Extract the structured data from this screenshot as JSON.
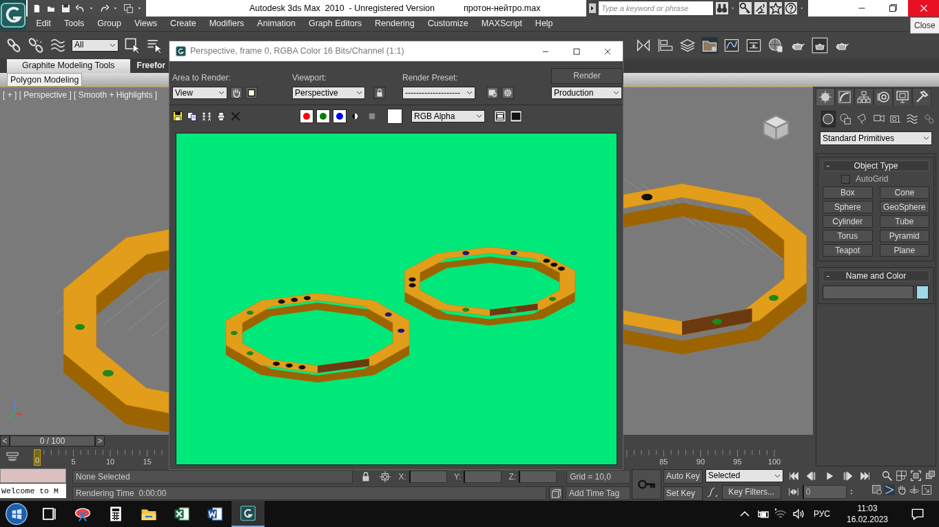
{
  "window": {
    "title": "Autodesk 3ds Max  2010  - Unregistered Version",
    "file_name": "протон-нейтро.max",
    "close_tooltip": "Close"
  },
  "search": {
    "placeholder": "Type a keyword or phrase"
  },
  "menu": [
    "Edit",
    "Tools",
    "Group",
    "Views",
    "Create",
    "Modifiers",
    "Animation",
    "Graph Editors",
    "Rendering",
    "Customize",
    "MAXScript",
    "Help"
  ],
  "toolbar": {
    "selection_filter": "All"
  },
  "ribbon": {
    "tabs": [
      {
        "label": "Graphite Modeling Tools",
        "selected": true
      },
      {
        "label": "Freefor",
        "selected": false
      }
    ],
    "panel_tab": "Polygon Modeling"
  },
  "viewport": {
    "label": "[ + ] [ Perspective ] [ Smooth + Highlights ]"
  },
  "command_panel": {
    "tabs": [
      {
        "selected": true
      },
      {
        "selected": false
      },
      {
        "selected": false
      },
      {
        "selected": false
      },
      {
        "selected": false
      },
      {
        "selected": false
      }
    ],
    "categories": [
      {
        "selected": true
      },
      {
        "selected": false
      },
      {
        "selected": false
      },
      {
        "selected": false
      },
      {
        "selected": false
      },
      {
        "selected": false
      },
      {
        "selected": false
      }
    ],
    "type_list": "Standard Primitives",
    "object_type": {
      "collapse_toggle": "-",
      "title": "Object Type",
      "autogrid": {
        "label": "AutoGrid",
        "checked": false
      },
      "buttons": [
        "Box",
        "Cone",
        "Sphere",
        "GeoSphere",
        "Cylinder",
        "Tube",
        "Torus",
        "Pyramid",
        "Teapot",
        "Plane"
      ]
    },
    "name_and_color": {
      "collapse_toggle": "-",
      "title": "Name and Color"
    }
  },
  "time_slider": {
    "prev": "<",
    "position": "0 / 100",
    "next": ">",
    "level": 0
  },
  "track_bar": {
    "current_frame": "0",
    "ticks": [
      "5",
      "10",
      "15",
      "85",
      "90",
      "95",
      "100"
    ]
  },
  "status": {
    "maxscript_output": "Welcome to M",
    "selection": "None Selected",
    "render_time": "Rendering Time  0:00:00",
    "x_label": "X:",
    "y_label": "Y:",
    "z_label": "Z:",
    "grid": "Grid = 10,0",
    "time_tag": "Add Time Tag"
  },
  "animation": {
    "auto_key": {
      "label": "Auto Key",
      "on": false
    },
    "set_key": "Set Key",
    "key_mode": "Selected",
    "key_filters": "Key Filters...",
    "frame": "0"
  },
  "render_window": {
    "title": "Perspective, frame 0, RGBA Color 16 Bits/Channel (1:1)",
    "area_label": "Area to Render:",
    "area": "View",
    "viewport_label": "Viewport:",
    "viewport": "Perspective",
    "preset_label": "Render Preset:",
    "preset": "--------------------",
    "render_button": "Render",
    "mode": "Production",
    "channel_display": "RGB Alpha",
    "channels": [
      {
        "color": "#ff0000",
        "on": true
      },
      {
        "color": "#008000",
        "on": true
      },
      {
        "color": "#0000ff",
        "on": true
      }
    ]
  },
  "taskbar": {
    "apps": [
      {
        "kind": "task-view",
        "active": false
      },
      {
        "kind": "snipping",
        "active": false
      },
      {
        "kind": "calculator",
        "active": false
      },
      {
        "kind": "explorer",
        "active": false
      },
      {
        "kind": "spreadsheet",
        "active": false
      },
      {
        "kind": "document",
        "active": false
      },
      {
        "kind": "max",
        "active": true
      }
    ],
    "language": "РУС",
    "time": "11:03",
    "date": "16.02.2023"
  }
}
